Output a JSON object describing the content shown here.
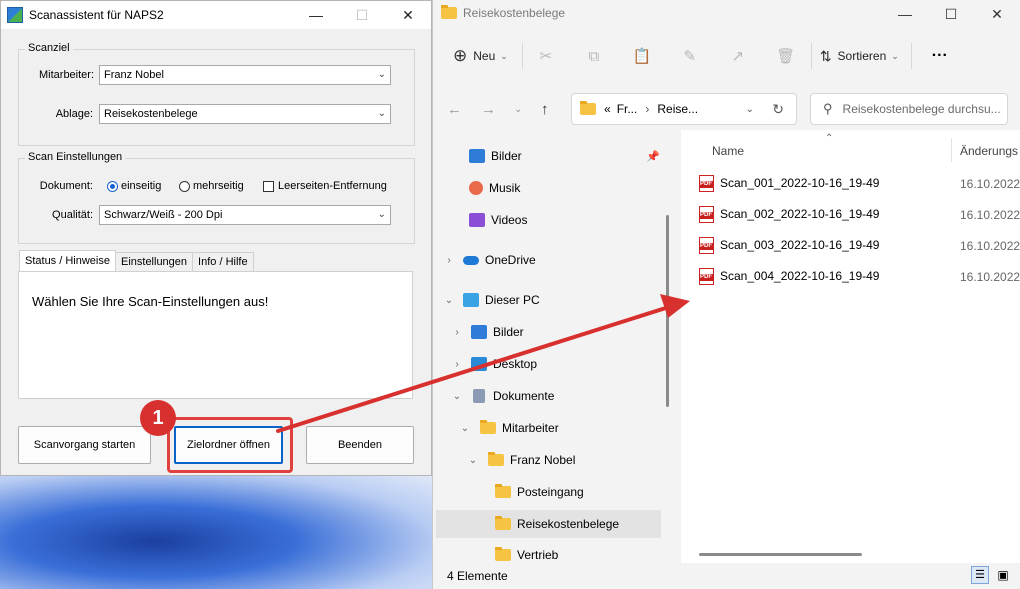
{
  "naps": {
    "title": "Scanassistent für NAPS2",
    "scanziel": {
      "legend": "Scanziel",
      "mitarbeiter_label": "Mitarbeiter:",
      "mitarbeiter_value": "Franz Nobel",
      "ablage_label": "Ablage:",
      "ablage_value": "Reisekostenbelege"
    },
    "scan_settings": {
      "legend": "Scan Einstellungen",
      "dokument_label": "Dokument:",
      "radio_einseitig": "einseitig",
      "radio_mehrseitig": "mehrseitig",
      "checkbox_leerseiten": "Leerseiten-Entfernung",
      "qualitaet_label": "Qualität:",
      "qualitaet_value": "Schwarz/Weiß - 200 Dpi"
    },
    "tabs": [
      "Status / Hinweise",
      "Einstellungen",
      "Info / Hilfe"
    ],
    "status_text": "Wählen Sie Ihre Scan-Einstellungen aus!",
    "buttons": {
      "start": "Scanvorgang starten",
      "open_folder": "Zielordner öffnen",
      "exit": "Beenden"
    },
    "step_badge": "1"
  },
  "explorer": {
    "title": "Reisekostenbelege",
    "toolbar": {
      "new_label": "Neu",
      "sort_label": "Sortieren",
      "more_label": "···"
    },
    "address": {
      "prefix": "«",
      "part1": "Fr...",
      "part2": "Reise..."
    },
    "search_placeholder": "Reisekostenbelege durchsu...",
    "nav_items": {
      "bilder_quick": "Bilder",
      "musik": "Musik",
      "videos": "Videos",
      "onedrive": "OneDrive",
      "dieser_pc": "Dieser PC",
      "bilder": "Bilder",
      "desktop": "Desktop",
      "dokumente": "Dokumente",
      "mitarbeiter": "Mitarbeiter",
      "franz_nobel": "Franz Nobel",
      "posteingang": "Posteingang",
      "reisekostenbelege": "Reisekostenbelege",
      "vertrieb": "Vertrieb"
    },
    "columns": {
      "name": "Name",
      "changed": "Änderungs"
    },
    "files": [
      {
        "name": "Scan_001_2022-10-16_19-49",
        "date": "16.10.2022"
      },
      {
        "name": "Scan_002_2022-10-16_19-49",
        "date": "16.10.2022"
      },
      {
        "name": "Scan_003_2022-10-16_19-49",
        "date": "16.10.2022"
      },
      {
        "name": "Scan_004_2022-10-16_19-49",
        "date": "16.10.2022"
      }
    ],
    "status_count": "4 Elemente"
  },
  "colors": {
    "annotation_red": "#d8302e",
    "folder_yellow": "#f6c343",
    "focus_blue": "#0a64c8"
  }
}
